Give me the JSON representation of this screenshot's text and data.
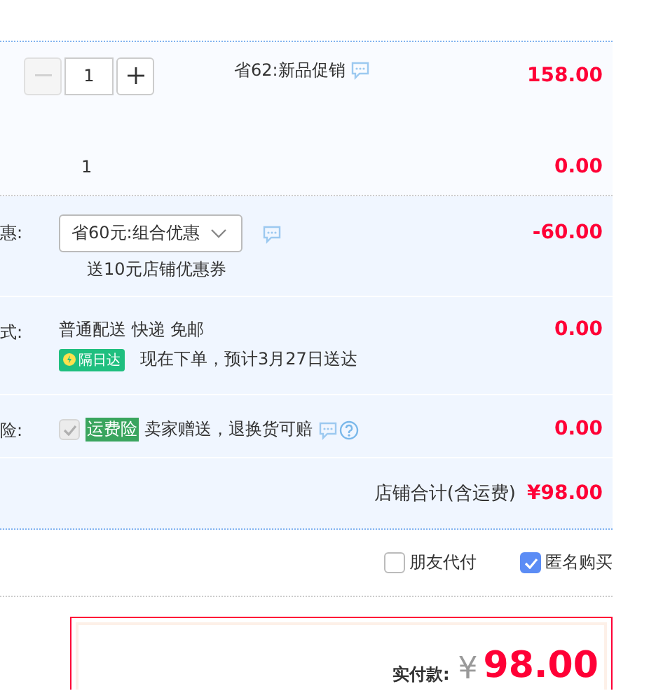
{
  "item": {
    "quantity": "1",
    "minus_disabled": true,
    "promo": "省62:新品促销",
    "price": "158.00",
    "extra_qty": "1",
    "extra_price": "0.00"
  },
  "discount": {
    "label": "惠:",
    "select": "省60元:组合优惠",
    "note": "送10元店铺优惠券",
    "amount": "-60.00"
  },
  "shipping": {
    "label": "式:",
    "method": "普通配送 快递 免邮",
    "badge": "隔日达",
    "eta": "现在下单，预计3月27日送达",
    "amount": "0.00"
  },
  "insurance": {
    "label": "险:",
    "checked": true,
    "disabled": true,
    "tag": "运费险",
    "text": "卖家赠送，退换货可赔",
    "amount": "0.00"
  },
  "store_total": {
    "label": "店铺合计(含运费)",
    "amount": "¥98.00"
  },
  "options": [
    {
      "label": "朋友代付",
      "checked": false
    },
    {
      "label": "匿名购买",
      "checked": true
    }
  ],
  "payment": {
    "label": "实付款:",
    "currency": "¥",
    "amount": "98.00"
  }
}
